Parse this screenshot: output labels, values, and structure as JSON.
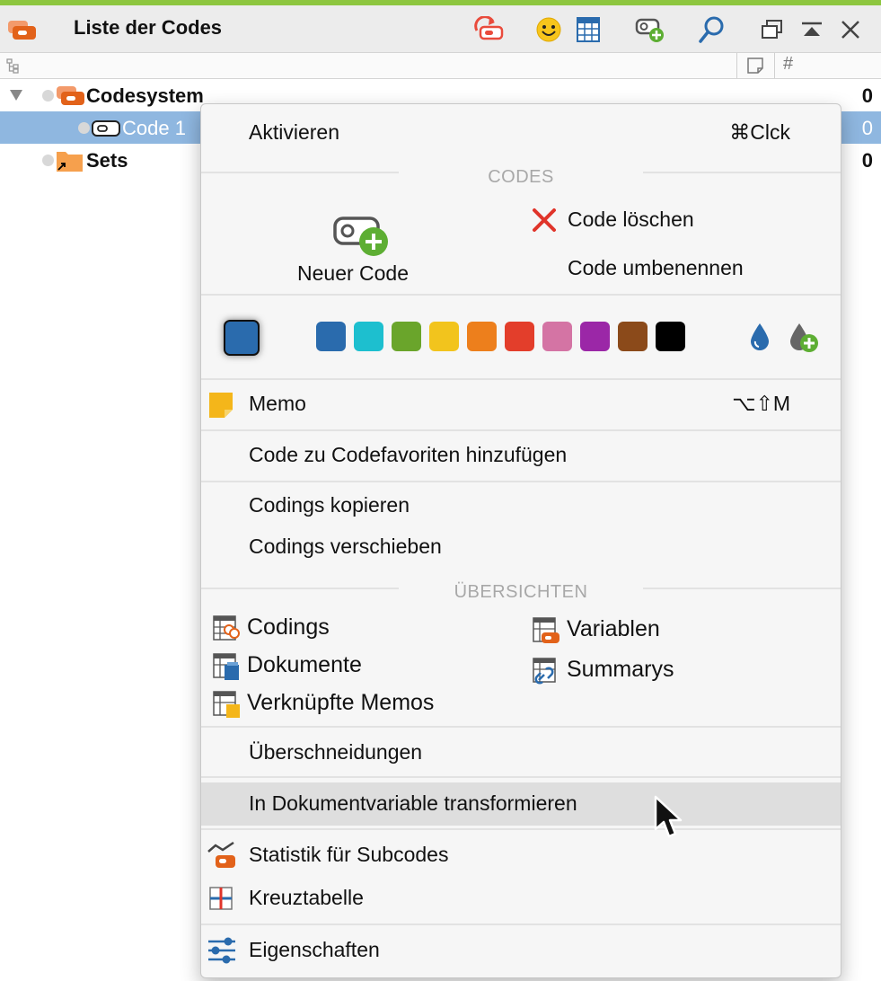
{
  "panel": {
    "title": "Liste der Codes",
    "toolbar_icons": [
      "activate-codes-icon",
      "smiley-icon",
      "grid-table-icon",
      "new-code-icon",
      "search-icon",
      "undock-window-icon",
      "collapse-icon",
      "close-icon"
    ]
  },
  "column_header": {
    "memo_icon": "memo-column-icon",
    "count_symbol": "#"
  },
  "tree": [
    {
      "label": "Codesystem",
      "count": "0",
      "bold": true,
      "expanded": true
    },
    {
      "label": "Code 1",
      "count": "0",
      "bold": false,
      "selected": true
    },
    {
      "label": "Sets",
      "count": "0",
      "bold": true
    }
  ],
  "menu": {
    "activate": {
      "label": "Aktivieren",
      "shortcut": "⌘Clck"
    },
    "section_codes": "CODES",
    "new_code": "Neuer Code",
    "delete_code": "Code löschen",
    "rename_code": "Code umbenennen",
    "colors": {
      "current": "#2a6bad",
      "palette": [
        "#2a6bad",
        "#1dbfcf",
        "#6aa52b",
        "#f2c41d",
        "#ed7f1c",
        "#e33e2b",
        "#d474a4",
        "#9b27a7",
        "#8b4a1a",
        "#000000"
      ]
    },
    "memo": {
      "label": "Memo",
      "shortcut": "⌥⇧M"
    },
    "add_favorite": "Code zu Codefavoriten hinzufügen",
    "copy_codings": "Codings kopieren",
    "move_codings": "Codings verschieben",
    "section_overviews": "ÜBERSICHTEN",
    "overviews": {
      "codings": "Codings",
      "documents": "Dokumente",
      "linked_memos": "Verknüpfte Memos",
      "variables": "Variablen",
      "summaries": "Summarys"
    },
    "intersections": "Überschneidungen",
    "transform": "In Dokumentvariable transformieren",
    "subcode_stats": "Statistik für Subcodes",
    "crosstab": "Kreuztabelle",
    "properties": "Eigenschaften"
  }
}
